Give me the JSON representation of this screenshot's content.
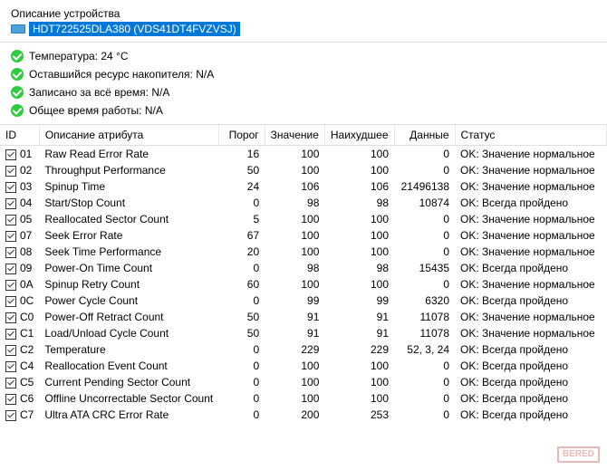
{
  "header": {
    "device_desc_label": "Описание устройства",
    "device_name": "HDT722525DLA380 (VDS41DT4FVZVSJ)"
  },
  "status": {
    "temperature": "Температура: 24 °C",
    "resource": "Оставшийся ресурс накопителя: N/A",
    "written": "Записано за всё время: N/A",
    "uptime": "Общее время работы: N/A"
  },
  "table": {
    "headers": {
      "id": "ID",
      "desc": "Описание атрибута",
      "threshold": "Порог",
      "value": "Значение",
      "worst": "Наихудшее",
      "data": "Данные",
      "status": "Статус"
    },
    "rows": [
      {
        "id": "01",
        "desc": "Raw Read Error Rate",
        "threshold": "16",
        "value": "100",
        "worst": "100",
        "data": "0",
        "status": "OK: Значение нормальное"
      },
      {
        "id": "02",
        "desc": "Throughput Performance",
        "threshold": "50",
        "value": "100",
        "worst": "100",
        "data": "0",
        "status": "OK: Значение нормальное"
      },
      {
        "id": "03",
        "desc": "Spinup Time",
        "threshold": "24",
        "value": "106",
        "worst": "106",
        "data": "21496138",
        "status": "OK: Значение нормальное"
      },
      {
        "id": "04",
        "desc": "Start/Stop Count",
        "threshold": "0",
        "value": "98",
        "worst": "98",
        "data": "10874",
        "status": "OK: Всегда пройдено"
      },
      {
        "id": "05",
        "desc": "Reallocated Sector Count",
        "threshold": "5",
        "value": "100",
        "worst": "100",
        "data": "0",
        "status": "OK: Значение нормальное"
      },
      {
        "id": "07",
        "desc": "Seek Error Rate",
        "threshold": "67",
        "value": "100",
        "worst": "100",
        "data": "0",
        "status": "OK: Значение нормальное"
      },
      {
        "id": "08",
        "desc": "Seek Time Performance",
        "threshold": "20",
        "value": "100",
        "worst": "100",
        "data": "0",
        "status": "OK: Значение нормальное"
      },
      {
        "id": "09",
        "desc": "Power-On Time Count",
        "threshold": "0",
        "value": "98",
        "worst": "98",
        "data": "15435",
        "status": "OK: Всегда пройдено"
      },
      {
        "id": "0A",
        "desc": "Spinup Retry Count",
        "threshold": "60",
        "value": "100",
        "worst": "100",
        "data": "0",
        "status": "OK: Значение нормальное"
      },
      {
        "id": "0C",
        "desc": "Power Cycle Count",
        "threshold": "0",
        "value": "99",
        "worst": "99",
        "data": "6320",
        "status": "OK: Всегда пройдено"
      },
      {
        "id": "C0",
        "desc": "Power-Off Retract Count",
        "threshold": "50",
        "value": "91",
        "worst": "91",
        "data": "11078",
        "status": "OK: Значение нормальное"
      },
      {
        "id": "C1",
        "desc": "Load/Unload Cycle Count",
        "threshold": "50",
        "value": "91",
        "worst": "91",
        "data": "11078",
        "status": "OK: Значение нормальное"
      },
      {
        "id": "C2",
        "desc": "Temperature",
        "threshold": "0",
        "value": "229",
        "worst": "229",
        "data": "52, 3, 24",
        "status": "OK: Всегда пройдено"
      },
      {
        "id": "C4",
        "desc": "Reallocation Event Count",
        "threshold": "0",
        "value": "100",
        "worst": "100",
        "data": "0",
        "status": "OK: Всегда пройдено"
      },
      {
        "id": "C5",
        "desc": "Current Pending Sector Count",
        "threshold": "0",
        "value": "100",
        "worst": "100",
        "data": "0",
        "status": "OK: Всегда пройдено"
      },
      {
        "id": "C6",
        "desc": "Offline Uncorrectable Sector Count",
        "threshold": "0",
        "value": "100",
        "worst": "100",
        "data": "0",
        "status": "OK: Всегда пройдено"
      },
      {
        "id": "C7",
        "desc": "Ultra ATA CRC Error Rate",
        "threshold": "0",
        "value": "200",
        "worst": "253",
        "data": "0",
        "status": "OK: Всегда пройдено"
      }
    ]
  },
  "watermark": "BERED"
}
